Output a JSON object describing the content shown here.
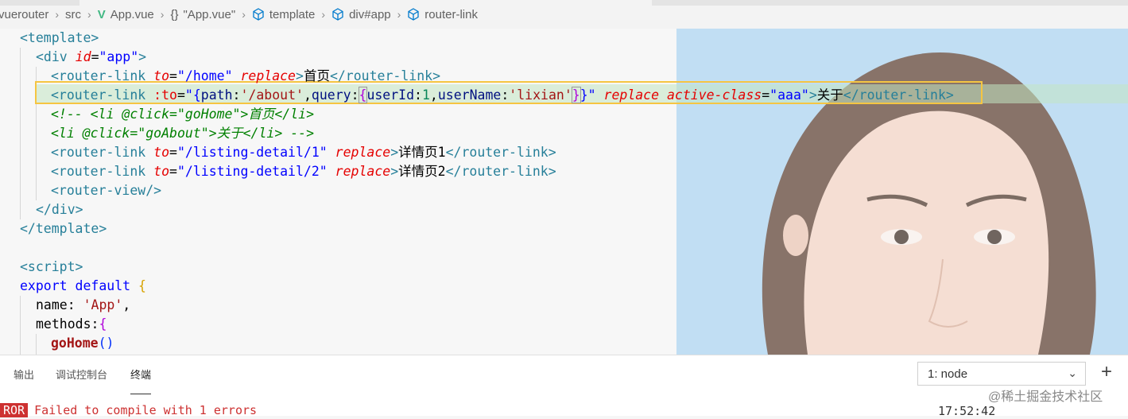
{
  "breadcrumb": {
    "items": [
      "vuerouter",
      "src",
      "App.vue",
      "\"App.vue\"",
      "template",
      "div#app",
      "router-link"
    ],
    "braces": "{}"
  },
  "code": {
    "l1": "<template>",
    "l2_open": "<div",
    "l2_attr": "id",
    "l2_val": "\"app\"",
    "l2_close": ">",
    "l3_tag": "<router-link",
    "l3_attr": "to",
    "l3_val": "\"/home\"",
    "l3_attr2": "replace",
    "l3_text": "首页",
    "l3_end": "</router-link>",
    "l4_tag": "<router-link",
    "l4_bind": ":to",
    "l4_q1": "\"{",
    "l4_k1": "path",
    "l4_v1": "'/about'",
    "l4_k2": "query",
    "l4_k3": "userId",
    "l4_n3": "1",
    "l4_k4": "userName",
    "l4_v4": "'lixian'",
    "l4_q2": "}\"",
    "l4_attr2": "replace",
    "l4_attr3": "active-class",
    "l4_val3": "\"aaa\"",
    "l4_text": "关于",
    "l4_end": "</router-link>",
    "l5": "<!-- <li @click=\"goHome\">首页</li>",
    "l6": "<li @click=\"goAbout\">关于</li> -->",
    "l7_tag": "<router-link",
    "l7_attr": "to",
    "l7_val": "\"/listing-detail/1\"",
    "l7_attr2": "replace",
    "l7_text": "详情页1",
    "l7_end": "</router-link>",
    "l8_tag": "<router-link",
    "l8_attr": "to",
    "l8_val": "\"/listing-detail/2\"",
    "l8_attr2": "replace",
    "l8_text": "详情页2",
    "l8_end": "</router-link>",
    "l9": "<router-view/>",
    "l10": "</div>",
    "l11": "</template>",
    "l13": "<script>",
    "l14_kw": "export default",
    "l14_brace": "{",
    "l15_key": "name",
    "l15_val": "'App'",
    "l16_key": "methods",
    "l16_brace": "{",
    "l17_fn": "goHome",
    "l17_paren": "()"
  },
  "panel": {
    "tabs": [
      "输出",
      "调试控制台",
      "终端"
    ],
    "active_tab": "终端",
    "terminal_select": "1: node",
    "add_label": "+",
    "error_badge": "ROR",
    "error_text": "Failed to compile with 1 errors",
    "time": "17:52:42",
    "watermark": "@稀土掘金技术社区"
  }
}
